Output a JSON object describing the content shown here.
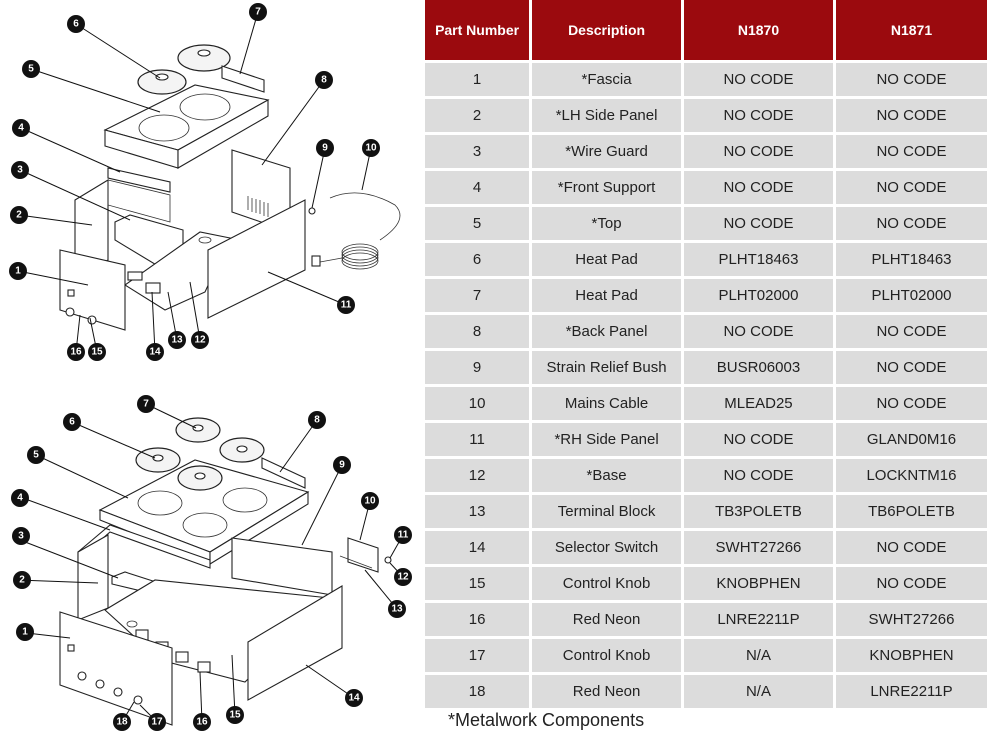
{
  "table": {
    "headers": [
      "Part Number",
      "Description",
      "N1870",
      "N1871"
    ],
    "rows": [
      {
        "part": "1",
        "description": "*Fascia",
        "n1870": "NO CODE",
        "n1871": "NO CODE"
      },
      {
        "part": "2",
        "description": "*LH Side Panel",
        "n1870": "NO CODE",
        "n1871": "NO CODE"
      },
      {
        "part": "3",
        "description": "*Wire Guard",
        "n1870": "NO CODE",
        "n1871": "NO CODE"
      },
      {
        "part": "4",
        "description": "*Front Support",
        "n1870": "NO CODE",
        "n1871": "NO CODE"
      },
      {
        "part": "5",
        "description": "*Top",
        "n1870": "NO CODE",
        "n1871": "NO CODE"
      },
      {
        "part": "6",
        "description": "Heat Pad",
        "n1870": "PLHT18463",
        "n1871": "PLHT18463"
      },
      {
        "part": "7",
        "description": "Heat Pad",
        "n1870": "PLHT02000",
        "n1871": "PLHT02000"
      },
      {
        "part": "8",
        "description": "*Back Panel",
        "n1870": "NO CODE",
        "n1871": "NO CODE"
      },
      {
        "part": "9",
        "description": "Strain Relief Bush",
        "n1870": "BUSR06003",
        "n1871": "NO CODE"
      },
      {
        "part": "10",
        "description": "Mains Cable",
        "n1870": "MLEAD25",
        "n1871": "NO CODE"
      },
      {
        "part": "11",
        "description": "*RH Side Panel",
        "n1870": "NO CODE",
        "n1871": "GLAND0M16"
      },
      {
        "part": "12",
        "description": "*Base",
        "n1870": "NO CODE",
        "n1871": "LOCKNTM16"
      },
      {
        "part": "13",
        "description": "Terminal Block",
        "n1870": "TB3POLETB",
        "n1871": "TB6POLETB"
      },
      {
        "part": "14",
        "description": "Selector Switch",
        "n1870": "SWHT27266",
        "n1871": "NO CODE"
      },
      {
        "part": "15",
        "description": "Control Knob",
        "n1870": "KNOBPHEN",
        "n1871": "NO CODE"
      },
      {
        "part": "16",
        "description": "Red Neon",
        "n1870": "LNRE2211P",
        "n1871": "SWHT27266"
      },
      {
        "part": "17",
        "description": "Control Knob",
        "n1870": "N/A",
        "n1871": "KNOBPHEN"
      },
      {
        "part": "18",
        "description": "Red Neon",
        "n1870": "N/A",
        "n1871": "LNRE2211P"
      }
    ],
    "footnote": "*Metalwork Components",
    "header_color": "#9b0a0e",
    "row_color": "#dcdcdc"
  },
  "diagrams": {
    "n1870_callouts": [
      "1",
      "2",
      "3",
      "4",
      "5",
      "6",
      "7",
      "8",
      "9",
      "10",
      "11",
      "12",
      "13",
      "14",
      "15",
      "16"
    ],
    "n1871_callouts": [
      "1",
      "2",
      "3",
      "4",
      "5",
      "6",
      "7",
      "8",
      "9",
      "10",
      "11",
      "12",
      "13",
      "14",
      "15",
      "16",
      "17",
      "18"
    ]
  }
}
